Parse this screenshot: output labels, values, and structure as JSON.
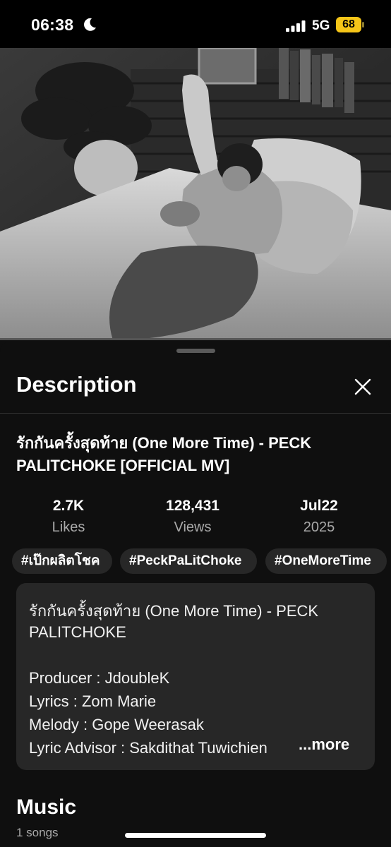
{
  "status_bar": {
    "time": "06:38",
    "network": "5G",
    "battery": "68",
    "icons": [
      "moon-icon",
      "signal-bars-icon",
      "battery-icon"
    ],
    "battery_color": "#f5c518"
  },
  "video": {
    "description": "Black and white music video frame of a man lying on a bed"
  },
  "sheet": {
    "title": "Description"
  },
  "video_info": {
    "title": "รักกันครั้งสุดท้าย (One More Time) - PECK PALITCHOKE [OFFICIAL MV]",
    "stats": [
      {
        "value": "2.7K",
        "label": "Likes"
      },
      {
        "value": "128,431",
        "label": "Views"
      },
      {
        "value": "Jul22",
        "label": "2025"
      }
    ],
    "hashtags": [
      "#เป๊กผลิตโชค",
      "#PeckPaLitChoke",
      "#OneMoreTime"
    ]
  },
  "description_box": {
    "lines": [
      "รักกันครั้งสุดท้าย (One More Time) - PECK",
      "PALITCHOKE",
      "",
      "Producer : JdoubleK",
      "Lyrics : Zom Marie",
      "Melody : Gope Weerasak",
      "Lyric Advisor : Sakdithat Tuwichien"
    ],
    "more_label": "...more"
  },
  "music": {
    "heading": "Music",
    "count": "1 songs"
  }
}
